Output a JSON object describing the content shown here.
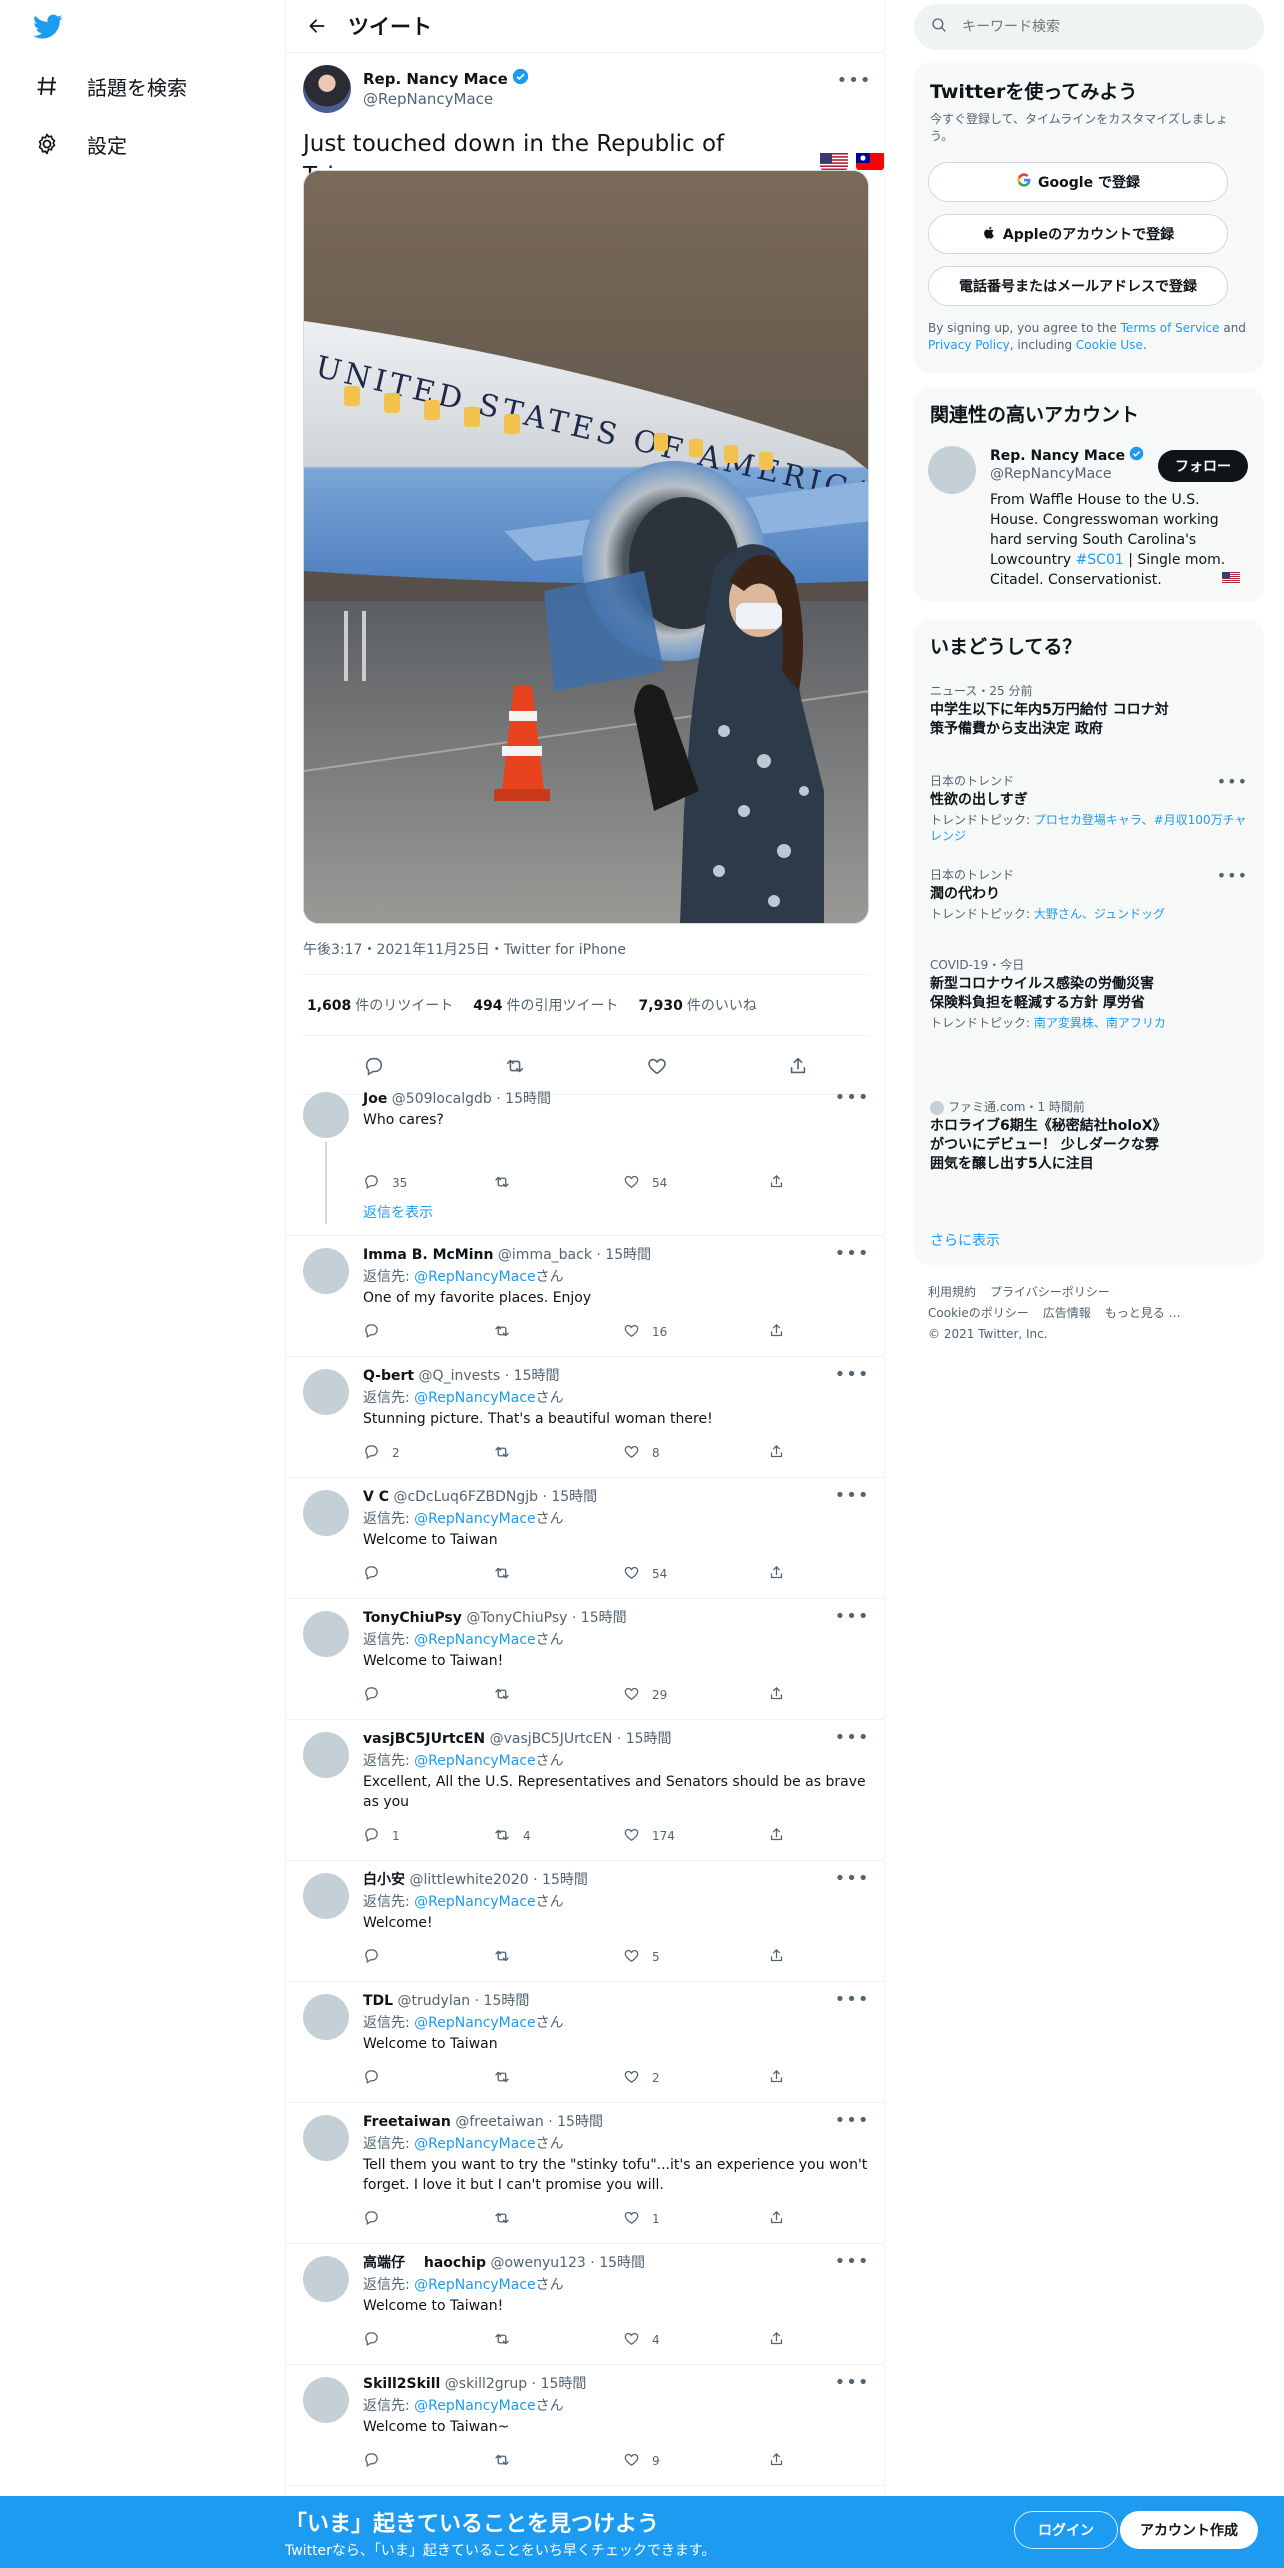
{
  "nav": {
    "explore_label": "話題を検索",
    "settings_label": "設定"
  },
  "header": {
    "title": "ツイート"
  },
  "tweet": {
    "name": "Rep. Nancy Mace",
    "handle": "@RepNancyMace",
    "text": "Just touched down in the Republic of Taiwan.",
    "timestamp": "午後3:17・2021年11月25日・Twitter for iPhone",
    "photo_text": "UNITED STATES OF AMERICA",
    "stats": {
      "retweets_num": "1,608",
      "retweets_label": "件のリツイート",
      "quotes_num": "494",
      "quotes_label": "件の引用ツイート",
      "likes_num": "7,930",
      "likes_label": "件のいいね"
    }
  },
  "replies_common": {
    "reply_to_prefix": "返信先: ",
    "reply_to_handle": "@RepNancyMace",
    "reply_to_suffix": "さん",
    "show_replies": "返信を表示"
  },
  "replies": [
    {
      "name": "Joe",
      "handle": "@509localgdb",
      "time": "15時間",
      "text": "Who cares?",
      "replies": "35",
      "retweets": "",
      "likes": "54",
      "has_to": false
    },
    {
      "name": "Imma B. McMinn",
      "handle": "@imma_back",
      "time": "15時間",
      "text": "One of my favorite places.  Enjoy",
      "replies": "",
      "retweets": "",
      "likes": "16",
      "has_to": true
    },
    {
      "name": "Q-bert",
      "handle": "@Q_invests",
      "time": "15時間",
      "text": "Stunning picture. That's a beautiful woman there!",
      "replies": "2",
      "retweets": "",
      "likes": "8",
      "has_to": true
    },
    {
      "name": "V C",
      "handle": "@cDcLuq6FZBDNgjb",
      "time": "15時間",
      "text": "Welcome to Taiwan",
      "replies": "",
      "retweets": "",
      "likes": "54",
      "has_to": true
    },
    {
      "name": "TonyChiuPsy",
      "handle": "@TonyChiuPsy",
      "time": "15時間",
      "text": "Welcome to Taiwan!",
      "replies": "",
      "retweets": "",
      "likes": "29",
      "has_to": true
    },
    {
      "name": "vasjBC5JUrtcEN",
      "handle": "@vasjBC5JUrtcEN",
      "time": "15時間",
      "text": "Excellent, All the U.S. Representatives and Senators should be as brave as you",
      "replies": "1",
      "retweets": "4",
      "likes": "174",
      "has_to": true
    },
    {
      "name": "白小安",
      "handle": "@littlewhite2020",
      "time": "15時間",
      "text": "Welcome!",
      "replies": "",
      "retweets": "",
      "likes": "5",
      "has_to": true
    },
    {
      "name": "TDL",
      "handle": "@trudylan",
      "time": "15時間",
      "text": "Welcome to Taiwan",
      "replies": "",
      "retweets": "",
      "likes": "2",
      "has_to": true
    },
    {
      "name": "Freetaiwan",
      "handle": "@freetaiwan",
      "time": "15時間",
      "text": "Tell them you want to try the \"stinky tofu\"...it's an experience you won't forget.   I love it but I can't promise you will.",
      "replies": "",
      "retweets": "",
      "likes": "1",
      "has_to": true
    },
    {
      "name": "高端仔　 haochip",
      "handle": "@owenyu123",
      "time": "15時間",
      "text": "Welcome to Taiwan!",
      "replies": "",
      "retweets": "",
      "likes": "4",
      "has_to": true
    },
    {
      "name": "Skill2Skill",
      "handle": "@skill2grup",
      "time": "15時間",
      "text": "Welcome to Taiwan~",
      "replies": "",
      "retweets": "",
      "likes": "9",
      "has_to": true
    }
  ],
  "search": {
    "placeholder": "キーワード検索"
  },
  "signup_card": {
    "title": "Twitterを使ってみよう",
    "subtitle": "今すぐ登録して、タイムラインをカスタマイズしましょう。",
    "google": "Google で登録",
    "apple": "Appleのアカウントで登録",
    "phone": "電話番号またはメールアドレスで登録",
    "terms_prefix": "By signing up, you agree to the ",
    "terms_link": "Terms of Service",
    "terms_and": " and ",
    "privacy_link": "Privacy Policy",
    "terms_including": ", including ",
    "cookie_link": "Cookie Use",
    "terms_end": "."
  },
  "related_card": {
    "title": "関連性の高いアカウント",
    "name": "Rep. Nancy Mace",
    "handle": "@RepNancyMace",
    "follow": "フォロー",
    "bio_1": "From Waffle House to the U.S. House. Congresswoman working hard serving South Carolina's Lowcountry ",
    "bio_tag": "#SC01",
    "bio_2": " | Single mom. Citadel. Conservationist."
  },
  "trends_card": {
    "title": "いまどうしてる？",
    "items": [
      {
        "meta": "ニュース・25 分前",
        "title": "中学生以下に年内5万円給付 コロナ対策予備費から支出決定 政府",
        "sub_prefix": "",
        "sub_links": ""
      },
      {
        "meta": "日本のトレンド",
        "title": "性欲の出しすぎ",
        "sub_prefix": "トレンドトピック: ",
        "sub_links": "プロセカ登場キャラ、#月収100万チャレンジ"
      },
      {
        "meta": "日本のトレンド",
        "title": "潤の代わり",
        "sub_prefix": "トレンドトピック: ",
        "sub_links": "大野さん、ジュンドッグ"
      },
      {
        "meta": "COVID-19・今日",
        "title": "新型コロナウイルス感染の労働災害 保険料負担を軽減する方針 厚労省",
        "sub_prefix": "トレンドトピック: ",
        "sub_links": "南ア変異株、南アフリカ"
      },
      {
        "meta": "ファミ通.com・1 時間前",
        "title": "ホロライブ6期生《秘密結社holoX》がついにデビュー！ 少しダークな雰囲気を醸し出す5人に注目",
        "sub_prefix": "",
        "sub_links": ""
      }
    ],
    "show_more": "さらに表示"
  },
  "footer": {
    "terms": "利用規約",
    "privacy": "プライバシーポリシー",
    "cookie": "Cookieのポリシー",
    "ads": "広告情報",
    "more": "もっと見る …",
    "copyright": "© 2021 Twitter, Inc."
  },
  "banner": {
    "title": "「いま」起きていることを見つけよう",
    "subtitle": "Twitterなら、「いま」起きていることをいち早くチェックできます。",
    "login": "ログイン",
    "signup": "アカウント作成"
  },
  "colors": {
    "accent": "#1d9bf0",
    "text": "#0f1419",
    "muted": "#536471",
    "panel": "#f7f9f9",
    "like": "#536471"
  }
}
